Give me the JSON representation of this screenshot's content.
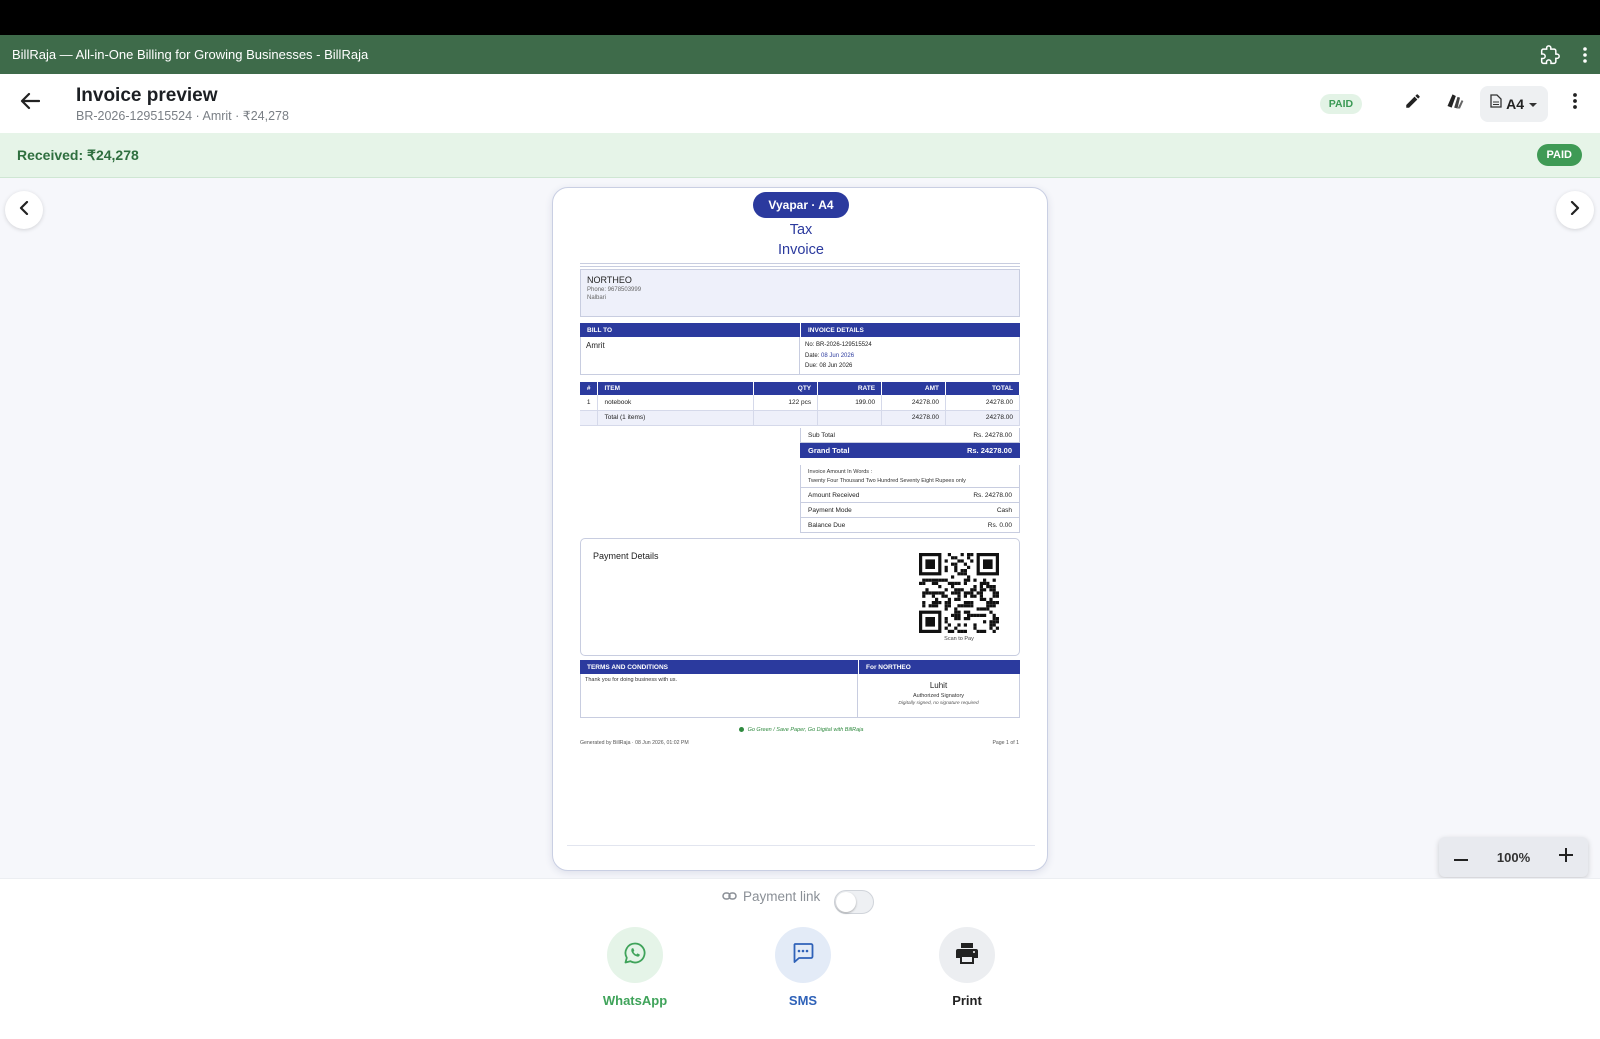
{
  "window": {
    "title": "BillRaja — All-in-One Billing for Growing Businesses - BillRaja",
    "icons": [
      "extension-icon",
      "more-vert-icon"
    ]
  },
  "appbar": {
    "title": "Invoice preview",
    "subtitle": "BR-2026-129515524 · Amrit · ₹24,278",
    "status_chip": "PAID",
    "paper_size": "A4",
    "icons": [
      "back-arrow-icon",
      "edit-pencil-icon",
      "theme-palette-icon",
      "document-icon",
      "dropdown-caret-icon",
      "more-vert-icon"
    ]
  },
  "received_bar": {
    "text": "Received: ₹24,278",
    "status_chip": "PAID"
  },
  "preview": {
    "template_chip": "Vyapar · A4",
    "title_line1": "Tax",
    "title_line2": "Invoice",
    "seller": {
      "name": "NORTHEO",
      "phone": "Phone: 9678503999",
      "address": "Nalbari"
    },
    "bill_to": {
      "header": "BILL TO",
      "name": "Amrit"
    },
    "invoice_details": {
      "header": "INVOICE DETAILS",
      "no_label": "No:",
      "no": "BR-2026-129515524",
      "date_label": "Date:",
      "date": "08 Jun 2026",
      "due_label": "Due:",
      "due": "08 Jun 2026"
    },
    "items_table": {
      "headers": [
        "#",
        "ITEM",
        "QTY",
        "RATE",
        "AMT",
        "TOTAL"
      ],
      "rows": [
        [
          "1",
          "notebook",
          "122 pcs",
          "199.00",
          "24278.00",
          "24278.00"
        ]
      ],
      "total_row": [
        "",
        "Total (1 items)",
        "",
        "",
        "24278.00",
        "24278.00"
      ]
    },
    "summary": {
      "sub_total_label": "Sub Total",
      "sub_total": "Rs. 24278.00",
      "grand_total_label": "Grand Total",
      "grand_total": "Rs. 24278.00",
      "words_label": "Invoice Amount In Words :",
      "words": "Twenty Four Thousand Two Hundred Seventy Eight Rupees only",
      "received_label": "Amount Received",
      "received": "Rs. 24278.00",
      "mode_label": "Payment Mode",
      "mode": "Cash",
      "balance_label": "Balance Due",
      "balance": "Rs. 0.00"
    },
    "payment_details": {
      "title": "Payment Details",
      "qr_caption": "Scan to Pay"
    },
    "terms": {
      "header": "TERMS AND CONDITIONS",
      "text": "Thank you for doing business with us."
    },
    "signatory": {
      "header": "For NORTHEO",
      "name": "Luhit",
      "role": "Authorized Signatory",
      "note": "Digitally signed, no signature required"
    },
    "footer": {
      "go_green": "Go Green  /  Save Paper, Go Digital with BillRaja",
      "generated": "Generated by BillRaja · 08 Jun 2026, 01:02 PM",
      "page": "Page 1 of 1"
    }
  },
  "zoom": {
    "level": "100%",
    "icons": [
      "zoom-out-minus-icon",
      "zoom-in-plus-icon"
    ]
  },
  "navigation": {
    "icons": [
      "chevron-left-icon",
      "chevron-right-icon"
    ]
  },
  "bottom": {
    "payment_link_label": "Payment link",
    "payment_link_enabled": false,
    "actions": [
      {
        "label": "WhatsApp",
        "icon": "whatsapp-icon",
        "color": "#3fa35a",
        "bg": "#e5f4e8"
      },
      {
        "label": "SMS",
        "icon": "sms-chat-icon",
        "color": "#2f62b8",
        "bg": "#e3ebf7"
      },
      {
        "label": "Print",
        "icon": "printer-icon",
        "color": "#222222",
        "bg": "#eceef1"
      }
    ]
  },
  "colors": {
    "titlebar": "#3e6b4a",
    "accent_green": "#3f9a55",
    "invoice_blue": "#2b3a9e"
  }
}
